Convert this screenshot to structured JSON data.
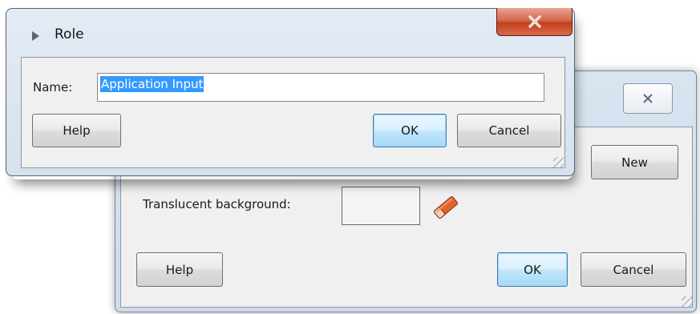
{
  "back_dialog": {
    "new_button": "New",
    "translucent_background_label": "Translucent background:",
    "help_button": "Help",
    "ok_button": "OK",
    "cancel_button": "Cancel",
    "close_icon": "close-icon",
    "eraser_icon": "eraser-icon",
    "swatch_color": "#f5f5f5"
  },
  "role_dialog": {
    "title": "Role",
    "title_icon": "triangle-right-icon",
    "name_label": "Name:",
    "name_value": "Application Input",
    "help_button": "Help",
    "ok_button": "OK",
    "cancel_button": "Cancel",
    "close_icon": "close-icon"
  },
  "colors": {
    "selection": "#3399ff",
    "close_button": "#c2401f",
    "window_frame": "#d6e1ee",
    "panel": "#f0f0f0"
  }
}
